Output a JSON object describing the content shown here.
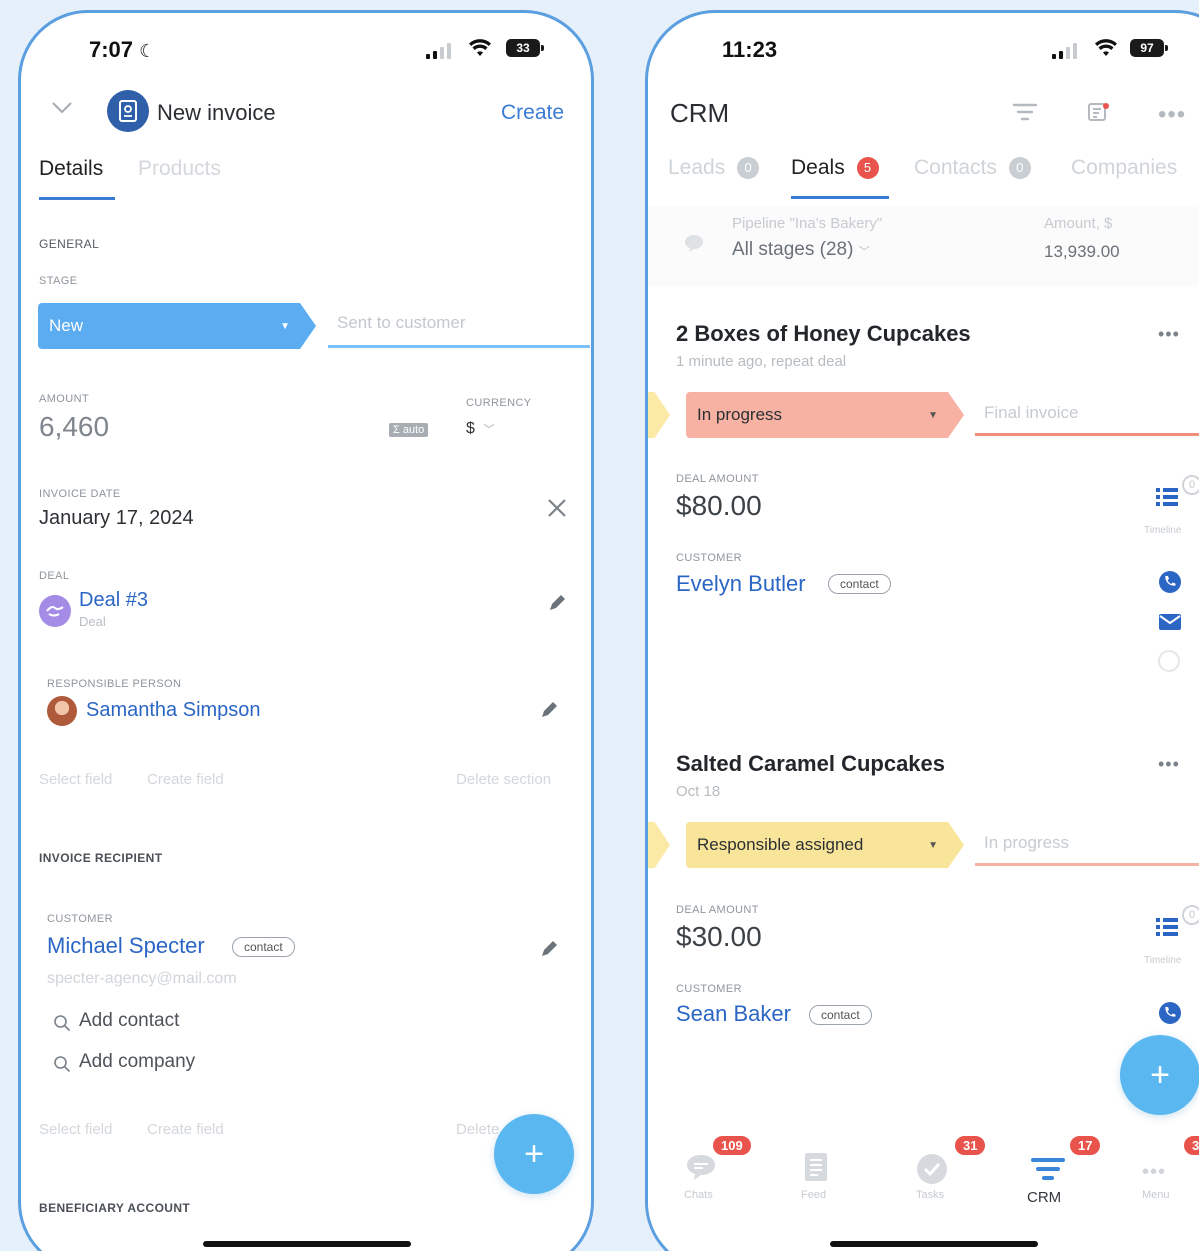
{
  "left": {
    "status": {
      "time": "7:07",
      "battery": "33"
    },
    "header": {
      "title": "New invoice",
      "action": "Create"
    },
    "tabs": [
      {
        "label": "Details"
      },
      {
        "label": "Products"
      }
    ],
    "general": {
      "section": "GENERAL",
      "stage_label": "STAGE",
      "stage_current": "New",
      "stage_next": "Sent to customer",
      "amount_label": "AMOUNT",
      "amount_value": "6,460",
      "auto_tag": "Σ auto",
      "currency_label": "CURRENCY",
      "currency_value": "$",
      "invoice_date_label": "INVOICE DATE",
      "invoice_date_value": "January 17, 2024",
      "deal_label": "DEAL",
      "deal_name": "Deal #3",
      "deal_sub": "Deal",
      "responsible_label": "RESPONSIBLE PERSON",
      "responsible_name": "Samantha Simpson",
      "select_field": "Select field",
      "create_field": "Create field",
      "delete_section": "Delete section"
    },
    "recipient": {
      "section": "INVOICE RECIPIENT",
      "customer_label": "CUSTOMER",
      "customer_name": "Michael Specter",
      "customer_tag": "contact",
      "customer_email": "specter-agency@mail.com",
      "add_contact": "Add contact",
      "add_company": "Add company",
      "select_field": "Select field",
      "create_field": "Create field",
      "delete_section": "Delete section"
    },
    "beneficiary": {
      "section": "BENEFICIARY ACCOUNT"
    }
  },
  "right": {
    "status": {
      "time": "11:23",
      "battery": "97"
    },
    "header": {
      "title": "CRM"
    },
    "tabs": [
      {
        "label": "Leads",
        "count": "0"
      },
      {
        "label": "Deals",
        "count": "5"
      },
      {
        "label": "Contacts",
        "count": "0"
      },
      {
        "label": "Companies",
        "count": ""
      }
    ],
    "pipeline": {
      "name": "Pipeline \"Ina's Bakery\"",
      "stages": "All stages (28)",
      "amount_label": "Amount, $",
      "amount_value": "13,939.00"
    },
    "deals": [
      {
        "title": "2 Boxes of Honey Cupcakes",
        "subtitle": "1 minute ago, repeat deal",
        "stage": "In progress",
        "next_stage": "Final invoice",
        "amount_label": "DEAL AMOUNT",
        "amount": "$80.00",
        "customer_label": "CUSTOMER",
        "customer": "Evelyn Butler",
        "customer_tag": "contact",
        "timeline_label": "Timeline",
        "timeline_count": "0"
      },
      {
        "title": "Salted Caramel Cupcakes",
        "subtitle": "Oct 18",
        "stage": "Responsible assigned",
        "next_stage": "In progress",
        "amount_label": "DEAL AMOUNT",
        "amount": "$30.00",
        "customer_label": "CUSTOMER",
        "customer": "Sean Baker",
        "customer_tag": "contact",
        "timeline_label": "Timeline",
        "timeline_count": "0"
      }
    ],
    "bottom_nav": [
      {
        "label": "Chats",
        "badge": "109"
      },
      {
        "label": "Feed",
        "badge": ""
      },
      {
        "label": "Tasks",
        "badge": "31"
      },
      {
        "label": "CRM",
        "badge": "17"
      },
      {
        "label": "Menu",
        "badge": "3"
      }
    ]
  },
  "colors": {
    "accent": "#2b66c5",
    "stage_new": "#5cacf2",
    "stage_in_progress": "#f7b2a4",
    "stage_responsible": "#f9e59a",
    "fab": "#5ab7ef",
    "badge": "#e8534b"
  }
}
